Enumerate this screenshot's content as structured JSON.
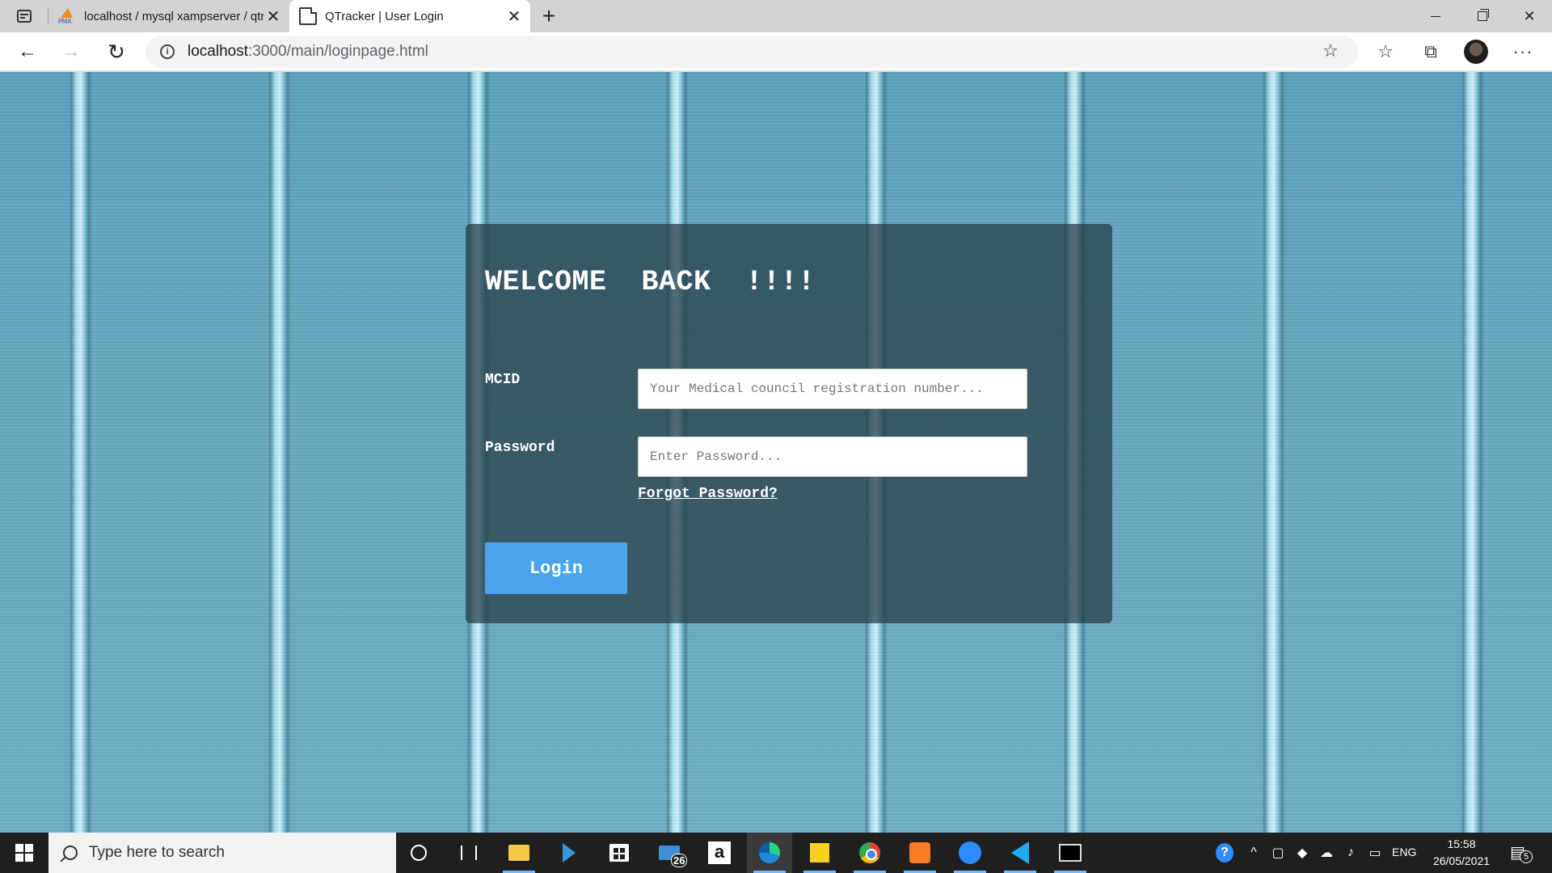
{
  "browser": {
    "tabs": [
      {
        "title": "localhost / mysql xampserver / qtracker",
        "favicon": "phpmyadmin-icon",
        "favicon_text": "PMA",
        "active": false
      },
      {
        "title": "QTracker | User Login",
        "favicon": "document-icon",
        "active": true
      }
    ],
    "new_tab_label": "+",
    "close_glyph": "✕",
    "address": {
      "host": "localhost",
      "rest": ":3000/main/loginpage.html"
    },
    "icons": {
      "back": "←",
      "forward": "→",
      "reload": "↻",
      "site_info": "i",
      "add_favorite": "☆",
      "favorites": "☆",
      "collections": "⧉",
      "more": "···"
    }
  },
  "login": {
    "heading": "WELCOME  BACK  !!!!",
    "mcid_label": "MCID",
    "mcid_placeholder": "Your Medical council registration number...",
    "password_label": "Password",
    "password_placeholder": "Enter Password...",
    "forgot_link": "Forgot Password?",
    "login_button": "Login"
  },
  "taskbar": {
    "search_placeholder": "Type here to search",
    "mail_badge": "26",
    "amazon_glyph": "a",
    "help_glyph": "?",
    "language": "ENG",
    "time": "15:58",
    "date": "26/05/2021",
    "notifications_count": "5"
  },
  "colors": {
    "login_button": "#4aa3ec",
    "card_background": "rgba(38,58,68,0.72)",
    "background_blue": "#6aa9c1"
  }
}
